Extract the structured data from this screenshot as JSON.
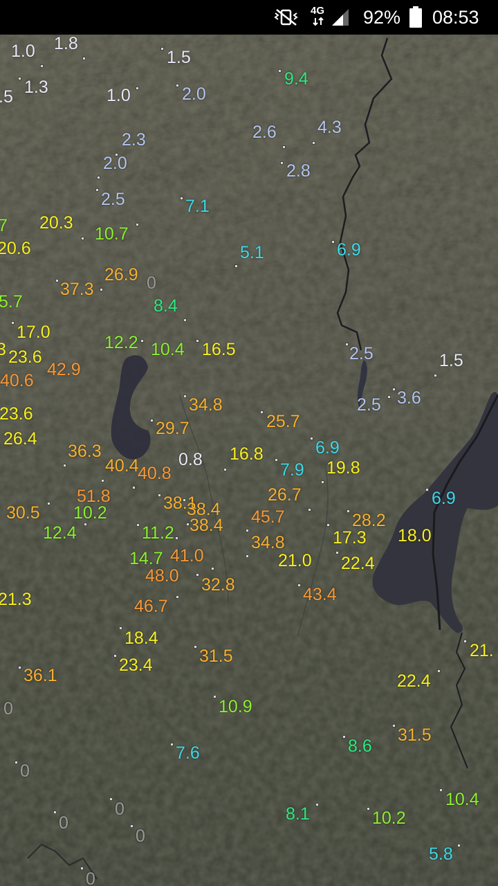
{
  "status_bar": {
    "network": "4G",
    "battery": "92%",
    "time": "08:53",
    "icons": [
      "vibrate-mute-icon",
      "signal-icon",
      "battery-icon"
    ]
  },
  "map": {
    "layer": "satellite",
    "legend_colors": {
      "under_2": "#e8e8f8",
      "2_to_5": "#b4c4f0",
      "5_to_8": "#40d8e8",
      "8_to_10": "#30e880",
      "10_to_15": "#8cf030",
      "15_to_25": "#f8f020",
      "25_to_40": "#f8b030",
      "40_plus": "#f89838"
    },
    "observations": [
      {
        "value": "1.0",
        "color": "#e8e8f8"
      },
      {
        "value": "1.8",
        "color": "#e8e8f8"
      },
      {
        "value": "1.5",
        "color": "#e8e8f8"
      },
      {
        "value": ".5",
        "color": "#e8e8f8"
      },
      {
        "value": "1.3",
        "color": "#e8e8f8"
      },
      {
        "value": "1.0",
        "color": "#e8e8f8"
      },
      {
        "value": "2.0",
        "color": "#b4c4f0"
      },
      {
        "value": "9.4",
        "color": "#30e880"
      },
      {
        "value": "2.6",
        "color": "#b4c4f0"
      },
      {
        "value": "4.3",
        "color": "#b4c4f0"
      },
      {
        "value": "2.3",
        "color": "#b4c4f0"
      },
      {
        "value": "2.0",
        "color": "#b4c4f0"
      },
      {
        "value": "2.8",
        "color": "#b4c4f0"
      },
      {
        "value": "2.5",
        "color": "#b4c4f0"
      },
      {
        "value": "7.1",
        "color": "#40d8e8"
      },
      {
        "value": "7",
        "color": "#8cf030"
      },
      {
        "value": "20.3",
        "color": "#f8f020"
      },
      {
        "value": "10.7",
        "color": "#8cf030"
      },
      {
        "value": "20.6",
        "color": "#f8f020"
      },
      {
        "value": "6.9",
        "color": "#40d8e8"
      },
      {
        "value": "5.1",
        "color": "#40d8e8"
      },
      {
        "value": "26.9",
        "color": "#f8b030"
      },
      {
        "value": "37.3",
        "color": "#f8b030"
      },
      {
        "value": "0",
        "color": "#9a9a9a"
      },
      {
        "value": "5.7",
        "color": "#8cf030"
      },
      {
        "value": "8.4",
        "color": "#30e880"
      },
      {
        "value": "17.0",
        "color": "#f8f020"
      },
      {
        "value": "12.2",
        "color": "#8cf030"
      },
      {
        "value": "10.4",
        "color": "#8cf030"
      },
      {
        "value": "16.5",
        "color": "#f8f020"
      },
      {
        "value": "3",
        "color": "#f8f020"
      },
      {
        "value": "23.6",
        "color": "#f8f020"
      },
      {
        "value": "42.9",
        "color": "#f89838"
      },
      {
        "value": "2.5",
        "color": "#b4c4f0"
      },
      {
        "value": "1.5",
        "color": "#e8e8f8"
      },
      {
        "value": "40.6",
        "color": "#f89838"
      },
      {
        "value": "34.8",
        "color": "#f8b030"
      },
      {
        "value": "2.5",
        "color": "#b4c4f0"
      },
      {
        "value": "3.6",
        "color": "#b4c4f0"
      },
      {
        "value": "23.6",
        "color": "#f8f020"
      },
      {
        "value": "29.7",
        "color": "#f8b030"
      },
      {
        "value": "25.7",
        "color": "#f8b030"
      },
      {
        "value": "26.4",
        "color": "#f8f020"
      },
      {
        "value": "6.9",
        "color": "#40d8e8"
      },
      {
        "value": "36.3",
        "color": "#f8b030"
      },
      {
        "value": "16.8",
        "color": "#f8f020"
      },
      {
        "value": "40.4",
        "color": "#f8b030"
      },
      {
        "value": "0.8",
        "color": "#e8e8f8"
      },
      {
        "value": "7.9",
        "color": "#40d8e8"
      },
      {
        "value": "19.8",
        "color": "#f8f020"
      },
      {
        "value": "40.8",
        "color": "#f89838"
      },
      {
        "value": "51.8",
        "color": "#f89838"
      },
      {
        "value": "6.9",
        "color": "#40d8e8"
      },
      {
        "value": "26.7",
        "color": "#f8b030"
      },
      {
        "value": "30.5",
        "color": "#f8b030"
      },
      {
        "value": "10.2",
        "color": "#8cf030"
      },
      {
        "value": "38.1",
        "color": "#f8b030"
      },
      {
        "value": "38.4",
        "color": "#f8b030"
      },
      {
        "value": "28.2",
        "color": "#f8b030"
      },
      {
        "value": "45.7",
        "color": "#f89838"
      },
      {
        "value": "12.4",
        "color": "#8cf030"
      },
      {
        "value": "11.2",
        "color": "#8cf030"
      },
      {
        "value": "38.4",
        "color": "#f8b030"
      },
      {
        "value": "17.3",
        "color": "#f8f020"
      },
      {
        "value": "18.0",
        "color": "#f8f020"
      },
      {
        "value": "34.8",
        "color": "#f8b030"
      },
      {
        "value": "14.7",
        "color": "#8cf030"
      },
      {
        "value": "41.0",
        "color": "#f89838"
      },
      {
        "value": "21.0",
        "color": "#f8f020"
      },
      {
        "value": "22.4",
        "color": "#f8f020"
      },
      {
        "value": "48.0",
        "color": "#f89838"
      },
      {
        "value": "32.8",
        "color": "#f8b030"
      },
      {
        "value": "43.4",
        "color": "#f89838"
      },
      {
        "value": "21.3",
        "color": "#f8f020"
      },
      {
        "value": "46.7",
        "color": "#f89838"
      },
      {
        "value": "18.4",
        "color": "#f8f020"
      },
      {
        "value": "21.",
        "color": "#f8f020"
      },
      {
        "value": "31.5",
        "color": "#f8b030"
      },
      {
        "value": "23.4",
        "color": "#f8f020"
      },
      {
        "value": "36.1",
        "color": "#f8b030"
      },
      {
        "value": "22.4",
        "color": "#f8f020"
      },
      {
        "value": "0",
        "color": "#9a9a9a"
      },
      {
        "value": "10.9",
        "color": "#8cf030"
      },
      {
        "value": "31.5",
        "color": "#f8b030"
      },
      {
        "value": "8.6",
        "color": "#30e880"
      },
      {
        "value": "7.6",
        "color": "#40d8e8"
      },
      {
        "value": "0",
        "color": "#9a9a9a"
      },
      {
        "value": "10.4",
        "color": "#8cf030"
      },
      {
        "value": "0",
        "color": "#9a9a9a"
      },
      {
        "value": "0",
        "color": "#9a9a9a"
      },
      {
        "value": "8.1",
        "color": "#30e880"
      },
      {
        "value": "10.2",
        "color": "#8cf030"
      },
      {
        "value": "0",
        "color": "#9a9a9a"
      },
      {
        "value": "5.8",
        "color": "#40d8e8"
      },
      {
        "value": "0",
        "color": "#9a9a9a"
      }
    ]
  }
}
